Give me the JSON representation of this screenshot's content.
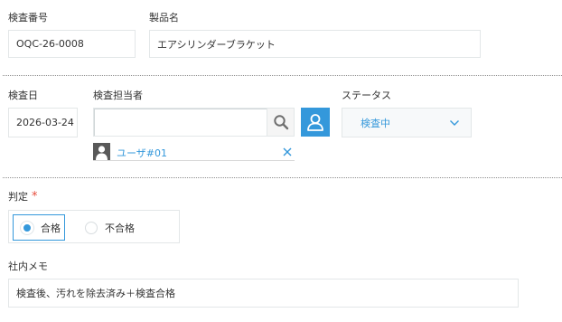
{
  "fields": {
    "inspection_number": {
      "label": "検査番号",
      "value": "OQC-26-0008"
    },
    "product_name": {
      "label": "製品名",
      "value": "エアシリンダーブラケット"
    },
    "inspection_date": {
      "label": "検査日",
      "value": "2026-03-24"
    },
    "inspector": {
      "label": "検査担当者",
      "search_value": "",
      "selected_user": "ユーザ#01"
    },
    "status": {
      "label": "ステータス",
      "value": "検査中"
    },
    "judgement": {
      "label": "判定",
      "required_mark": "*",
      "options": [
        "合格",
        "不合格"
      ],
      "selected": "合格"
    },
    "internal_memo": {
      "label": "社内メモ",
      "value": "検査後、汚れを除去済み＋検査合格"
    }
  },
  "colors": {
    "accent": "#3498db",
    "required": "#e74c3c",
    "field_border": "#e3e7e8",
    "divider": "#8f8f8f"
  },
  "icons": {
    "search": "search-icon",
    "user_select": "user-icon",
    "chip_avatar": "user-avatar-icon",
    "remove": "close-icon",
    "dropdown": "chevron-down-icon"
  }
}
